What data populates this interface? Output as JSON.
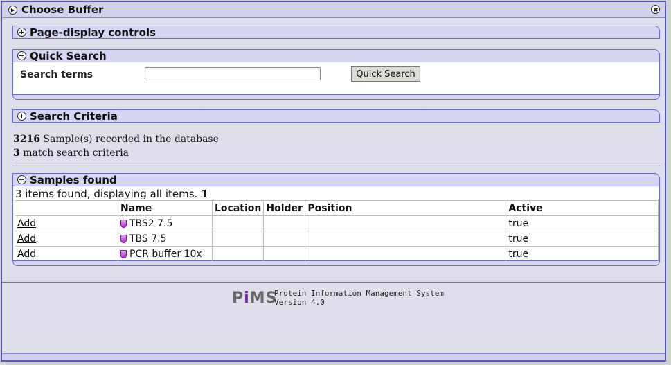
{
  "window": {
    "title": "Choose Buffer"
  },
  "sections": {
    "page_display": "Page-display controls",
    "quick_search": "Quick Search",
    "search_criteria": "Search Criteria",
    "samples_found": "Samples found"
  },
  "search": {
    "label": "Search terms",
    "value": "",
    "button": "Quick Search"
  },
  "stats": {
    "recorded_count": "3216",
    "recorded_text": "Sample(s) recorded in the database",
    "match_count": "3",
    "match_text": "match search criteria"
  },
  "results": {
    "summary": "3 items found, displaying all items.",
    "page": "1",
    "columns": [
      "",
      "Name",
      "Location",
      "Holder",
      "Position",
      "Active"
    ],
    "rows": [
      {
        "action": "Add",
        "name": "TBS2 7.5",
        "location": "",
        "holder": "",
        "position": "",
        "active": "true"
      },
      {
        "action": "Add",
        "name": "TBS 7.5",
        "location": "",
        "holder": "",
        "position": "",
        "active": "true"
      },
      {
        "action": "Add",
        "name": "PCR buffer 10x",
        "location": "",
        "holder": "",
        "position": "",
        "active": "true"
      }
    ]
  },
  "footer": {
    "logo_pre": "P",
    "logo_i": "i",
    "logo_post": "MS",
    "line1": "Protein Information Management System",
    "line2": "Version 4.0"
  },
  "colors": {
    "accent": "#6a6ad6",
    "header_bg": "#d6d6f2",
    "tube": "#c020e0"
  }
}
